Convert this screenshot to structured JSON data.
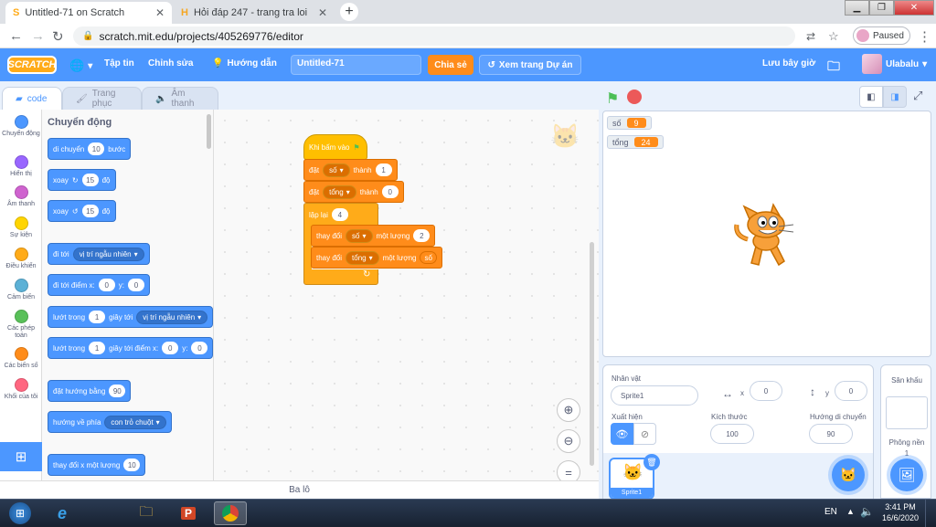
{
  "browser": {
    "tabs": [
      {
        "title": "Untitled-71 on Scratch",
        "active": true
      },
      {
        "title": "Hỏi đáp 247 - trang tra loi",
        "active": false
      }
    ],
    "url": "scratch.mit.edu/projects/405269776/editor",
    "profile_status": "Paused"
  },
  "menubar": {
    "logo": "SCRATCH",
    "file": "Tập tin",
    "edit": "Chỉnh sửa",
    "tutorials": "Hướng dẫn",
    "project_title": "Untitled-71",
    "share": "Chia sẻ",
    "see_project": "Xem trang Dự án",
    "save_now": "Lưu bây giờ",
    "username": "Ulabalu"
  },
  "editor_tabs": {
    "code": "code",
    "costumes": "Trang phục",
    "sounds": "Âm thanh"
  },
  "categories": [
    {
      "label": "Chuyển động",
      "color": "#4c97ff"
    },
    {
      "label": "Hiển thị",
      "color": "#9966ff"
    },
    {
      "label": "Âm thanh",
      "color": "#cf63cf"
    },
    {
      "label": "Sự kiện",
      "color": "#ffd500"
    },
    {
      "label": "Điều khiển",
      "color": "#ffab19"
    },
    {
      "label": "Cảm biến",
      "color": "#5cb1d6"
    },
    {
      "label": "Các phép toán",
      "color": "#59c059"
    },
    {
      "label": "Các biến số",
      "color": "#ff8c1a"
    },
    {
      "label": "Khối của tôi",
      "color": "#ff6680"
    }
  ],
  "palette": {
    "heading": "Chuyển động",
    "move": {
      "a": "di chuyển",
      "n": "10",
      "b": "bước"
    },
    "turn_right": {
      "a": "xoay",
      "n": "15",
      "b": "độ"
    },
    "turn_left": {
      "a": "xoay",
      "n": "15",
      "b": "độ"
    },
    "goto": {
      "a": "đi tới",
      "opt": "vị trí ngẫu nhiên"
    },
    "goto_xy": {
      "a": "đi tới điểm x:",
      "x": "0",
      "y_label": "y:",
      "y": "0"
    },
    "glide": {
      "a": "lướt trong",
      "n": "1",
      "b": "giây tới",
      "opt": "vị trí ngẫu nhiên"
    },
    "glide_xy": {
      "a": "lướt trong",
      "n": "1",
      "b": "giây tới điểm x:",
      "x": "0",
      "y_label": "y:",
      "y": "0"
    },
    "point_dir": {
      "a": "đặt hướng bằng",
      "n": "90"
    },
    "point_towards": {
      "a": "hướng về phía",
      "opt": "con trỏ chuột"
    },
    "change_x": {
      "a": "thay đổi x một lượng",
      "n": "10"
    }
  },
  "script": {
    "hat": "Khi bấm vào",
    "set1": {
      "a": "đặt",
      "var": "số",
      "b": "thành",
      "val": "1"
    },
    "set2": {
      "a": "đặt",
      "var": "tổng",
      "b": "thành",
      "val": "0"
    },
    "repeat": {
      "a": "lặp lại",
      "n": "4"
    },
    "change1": {
      "a": "thay đổi",
      "var": "số",
      "b": "một lượng",
      "val": "2"
    },
    "change2": {
      "a": "thay đổi",
      "var": "tổng",
      "b": "một lượng",
      "val": "số"
    }
  },
  "backpack": "Ba lô",
  "monitors": [
    {
      "name": "số",
      "value": "9"
    },
    {
      "name": "tổng",
      "value": "24"
    }
  ],
  "sprite_info": {
    "sprite_label": "Nhân vật",
    "sprite_name": "Sprite1",
    "x_label": "x",
    "x": "0",
    "y_label": "y",
    "y": "0",
    "show_label": "Xuất hiện",
    "size_label": "Kích thước",
    "size": "100",
    "direction_label": "Hướng di chuyển",
    "direction": "90",
    "thumb_name": "Sprite1"
  },
  "stage_panel": {
    "title": "Sân khấu",
    "backdrops_label": "Phông nền",
    "backdrops_count": "1"
  },
  "taskbar": {
    "lang": "EN",
    "time": "3:41 PM",
    "date": "16/6/2020"
  }
}
